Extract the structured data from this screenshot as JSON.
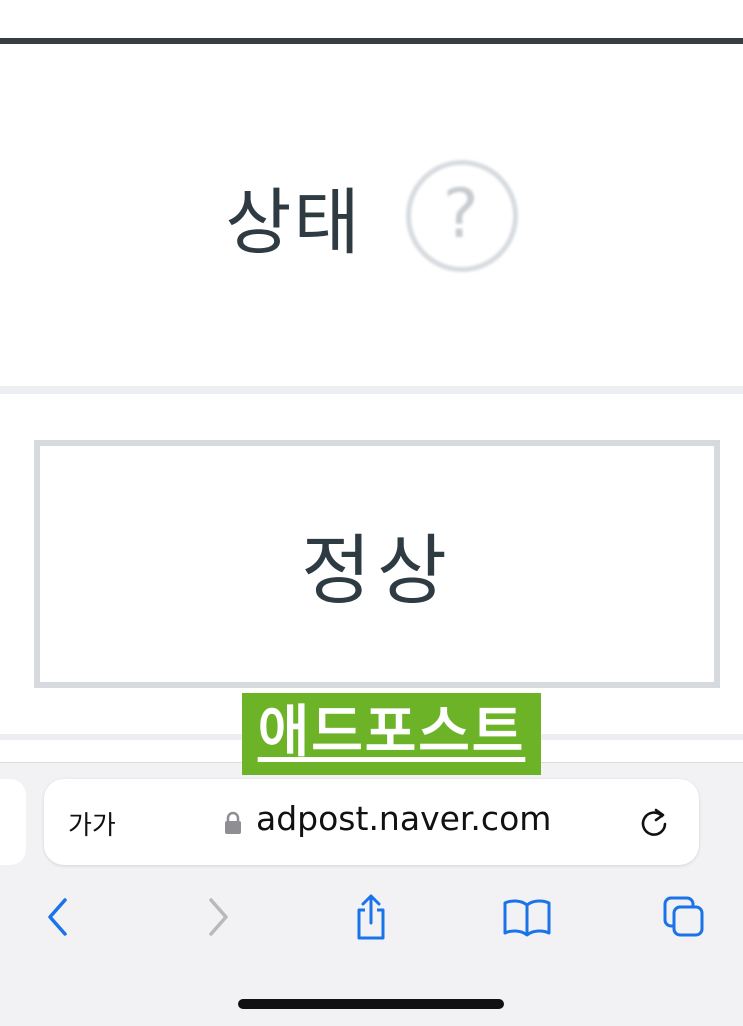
{
  "status_section": {
    "label": "상태",
    "help_icon_glyph": "?",
    "value": "정상"
  },
  "watermark": {
    "text": "애드포스트",
    "color": "#6db328"
  },
  "browser": {
    "text_size_button": "가가",
    "url": "adpost.naver.com",
    "toolbar": {
      "back": "chevron-left-icon",
      "forward": "chevron-right-icon",
      "share": "share-icon",
      "bookmarks": "book-icon",
      "tabs": "tabs-icon"
    },
    "accent_color": "#1a73e8"
  }
}
